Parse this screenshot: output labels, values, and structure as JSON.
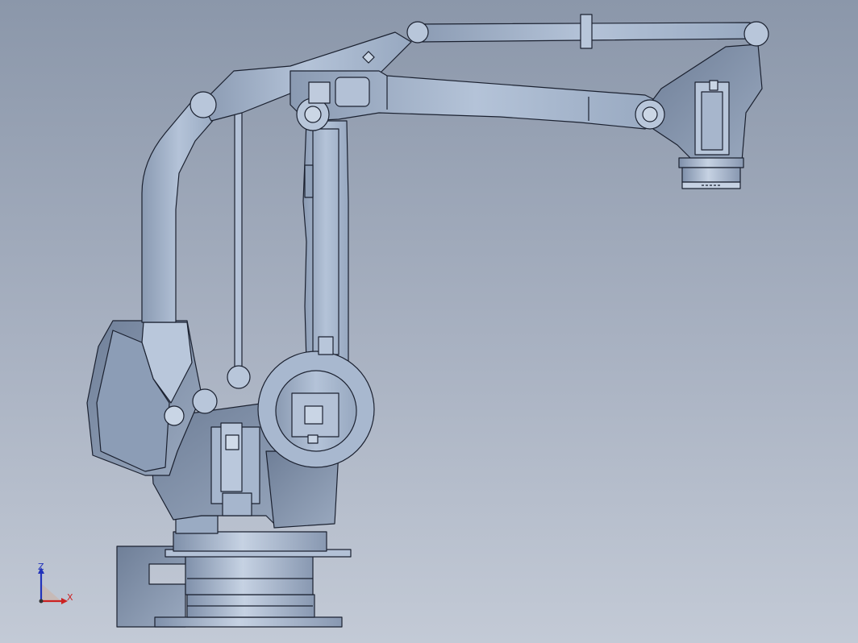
{
  "viewport": {
    "background_top": "#8b97aa",
    "background_bottom": "#c3cad6"
  },
  "model": {
    "name": "palletizing-robot",
    "body_color": "#a3b3c9",
    "edge_color": "#1b2130"
  },
  "triad": {
    "z_label": "Z",
    "x_label": "X",
    "z_color": "#2233bb",
    "x_color": "#cc2222"
  }
}
